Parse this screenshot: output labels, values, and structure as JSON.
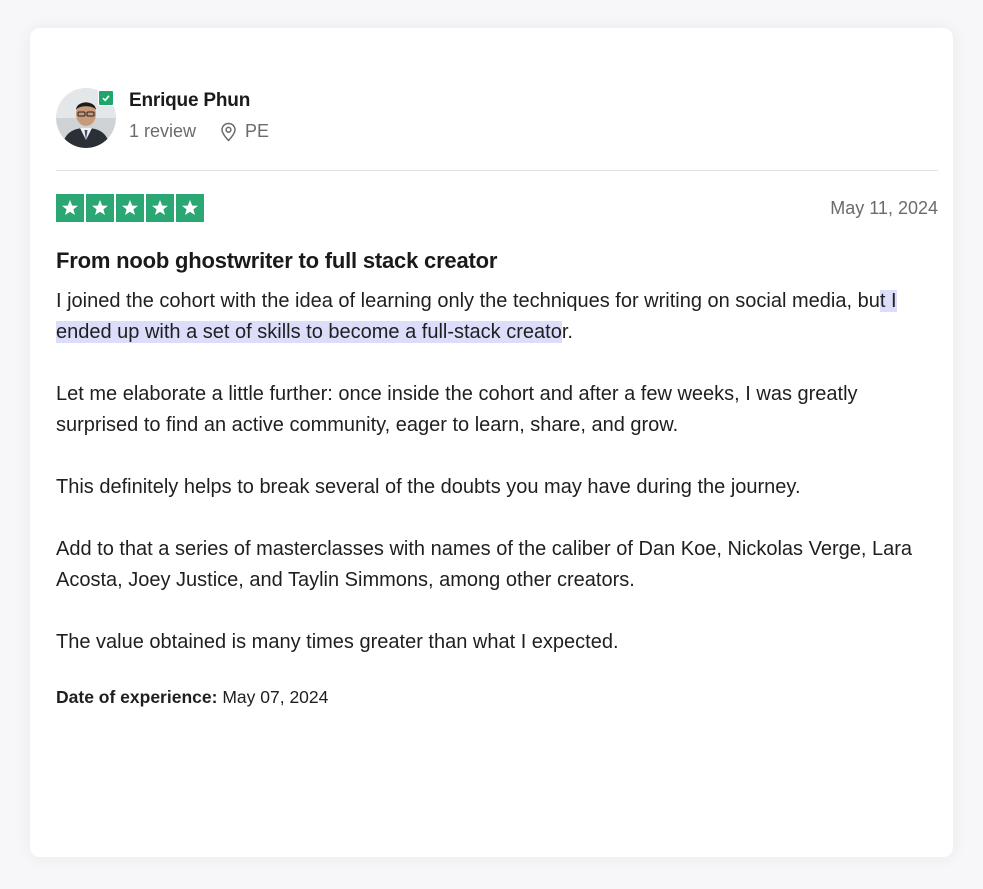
{
  "reviewer": {
    "name": "Enrique Phun",
    "review_count": "1 review",
    "location": "PE",
    "avatar_icon": "person-photo",
    "verified_icon": "check-badge-icon"
  },
  "review": {
    "rating": 5,
    "rating_max": 5,
    "star_color": "#2aa772",
    "date": "May 11, 2024",
    "title": "From noob ghostwriter to full stack creator",
    "p1_before": "I joined the cohort with the idea of learning only the techniques for writing on social media, bu",
    "p1_highlight": "t I ended up with a set of skills to become a full-stack creato",
    "p1_after": "r.",
    "p2": "Let me elaborate a little further: once inside the cohort and after a few weeks, I was greatly surprised to find an active community, eager to learn, share, and grow.",
    "p3": "This definitely helps to break several of the doubts you may have during the journey.",
    "p4": "Add to that a series of masterclasses with names of the caliber of Dan Koe, Nickolas Verge, Lara Acosta, Joey Justice, and Taylin Simmons, among other creators.",
    "p5": "The value obtained is many times greater than what I expected.",
    "experience_label": "Date of experience:",
    "experience_date": "May 07, 2024",
    "highlight_color": "#dcdcfb"
  }
}
